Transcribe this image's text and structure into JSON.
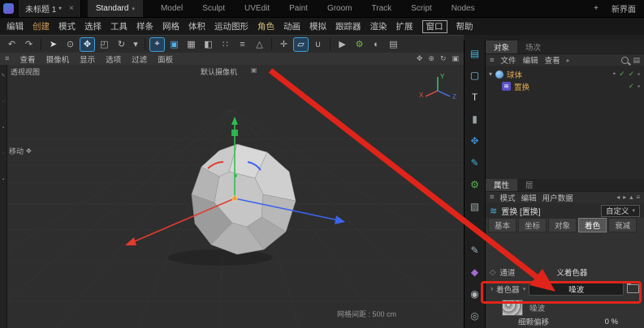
{
  "colors": {
    "annotation_red": "#e0241a",
    "check_green": "#51b44e",
    "axis_x": "#e23b2e",
    "axis_y": "#2fbf4f",
    "axis_z": "#3c64ee",
    "selected_orange": "#e0a850",
    "icon_teal": "#3fb4d8",
    "active_blue": "#3f9fd8"
  },
  "titlebar": {
    "tab": "未标题 1 *",
    "close": "×",
    "layout": "Standard",
    "layout_caret": "▾",
    "menus": [
      "Model",
      "Sculpt",
      "UVEdit",
      "Paint",
      "Groom",
      "Track",
      "Script",
      "Nodes"
    ],
    "plus": "+",
    "new_ui": "新界面"
  },
  "menubar": {
    "items": [
      "编辑",
      "创建",
      "模式",
      "选择",
      "工具",
      "样条",
      "网格",
      "体积",
      "运动图形",
      "角色",
      "动画",
      "模拟",
      "跟踪器",
      "渲染",
      "扩展",
      "窗口",
      "帮助"
    ]
  },
  "toolbar": {
    "icons": [
      {
        "name": "undo",
        "glyph": "↶"
      },
      {
        "name": "redo",
        "glyph": "↷"
      },
      {
        "name": "pointer",
        "glyph": "➤"
      },
      {
        "name": "live-selection",
        "glyph": "⊙"
      },
      {
        "name": "move-tool",
        "glyph": "✥"
      },
      {
        "name": "scale-tool",
        "glyph": "◰"
      },
      {
        "name": "rotate-tool",
        "glyph": "↻"
      },
      {
        "name": "last-tool",
        "glyph": "▾"
      },
      {
        "name": "coord-system",
        "glyph": "⌖"
      },
      {
        "name": "make-editable",
        "glyph": "▣"
      },
      {
        "name": "model-mode",
        "glyph": "▦"
      },
      {
        "name": "texture-mode",
        "glyph": "◧"
      },
      {
        "name": "points-mode",
        "glyph": "∷"
      },
      {
        "name": "edges-mode",
        "glyph": "≡"
      },
      {
        "name": "polygons-mode",
        "glyph": "△"
      },
      {
        "name": "axis-mode",
        "glyph": "✛"
      },
      {
        "name": "workplane",
        "glyph": "▱"
      },
      {
        "name": "snap",
        "glyph": "∪"
      },
      {
        "name": "render-view",
        "glyph": "▶"
      },
      {
        "name": "render-settings",
        "glyph": "⚙"
      },
      {
        "name": "material-manager",
        "glyph": "◐"
      },
      {
        "name": "content-browser",
        "glyph": "▤"
      }
    ]
  },
  "viewport": {
    "view_label": "透视视图",
    "camera_label": "默认摄像机",
    "camera_icon": "▣",
    "menu_icon": "≡",
    "menu": [
      "查看",
      "摄像机",
      "显示",
      "选项",
      "过滤",
      "面板"
    ],
    "nav_icons": [
      {
        "name": "pan",
        "glyph": "✥"
      },
      {
        "name": "zoom",
        "glyph": "⊕"
      },
      {
        "name": "orbit",
        "glyph": "↻"
      },
      {
        "name": "maximize",
        "glyph": "▣"
      }
    ],
    "move_label": "移动",
    "move_glyph": "✥",
    "grid_spacing": "网格间距 : 500 cm",
    "axis_x": "X",
    "axis_y": "Y",
    "axis_z": "Z"
  },
  "left_strip": {
    "icons": [
      {
        "name": "pen",
        "glyph": "✎"
      },
      {
        "name": "dot-a",
        "glyph": "◦"
      },
      {
        "name": "swatch-a",
        "glyph": "▪"
      },
      {
        "name": "dot-b",
        "glyph": "◦"
      },
      {
        "name": "swatch-b",
        "glyph": "▪"
      }
    ]
  },
  "right_toolbar": {
    "icons": [
      {
        "name": "layer-panel",
        "glyph": "▤"
      },
      {
        "name": "frame",
        "glyph": "▢"
      },
      {
        "name": "text-tool",
        "glyph": "T"
      },
      {
        "name": "column",
        "glyph": "▮"
      },
      {
        "name": "move-axes",
        "glyph": "✥"
      },
      {
        "name": "pen",
        "glyph": "✎"
      },
      {
        "name": "simulate-gear",
        "glyph": "⚙"
      },
      {
        "name": "cube",
        "glyph": "▧"
      },
      {
        "name": "spline",
        "glyph": "≈"
      },
      {
        "name": "pen-b",
        "glyph": "✎"
      },
      {
        "name": "deformer",
        "glyph": "◆"
      },
      {
        "name": "figure",
        "glyph": "◉"
      },
      {
        "name": "globe",
        "glyph": "◎"
      }
    ]
  },
  "object_panel": {
    "tabs": [
      "对象",
      "场次"
    ],
    "menu_icon": "≡",
    "menus": [
      "文件",
      "编辑",
      "查看"
    ],
    "overflow": "▸",
    "grid_icon": "▤",
    "tree": [
      {
        "expander": "▾",
        "label": "球体",
        "dot": "•",
        "check1": "✓",
        "check2": "✓",
        "tag": "▪"
      },
      {
        "icon": "≋",
        "label": "置换",
        "check1": "✓",
        "tag": "▪"
      }
    ]
  },
  "attributes": {
    "tabs": [
      "属性",
      "层"
    ],
    "menu_icon": "≡",
    "mode_menu": [
      "模式",
      "编辑",
      "用户数据"
    ],
    "nav": [
      "◂",
      "▸",
      "▴",
      "≡"
    ],
    "type_icon": "≋",
    "title": "置换 [置换]",
    "preset": "自定义",
    "preset_caret": "▾",
    "tab_items": [
      "基本",
      "坐标",
      "对象",
      "着色",
      "衰减"
    ],
    "channel_icon": "◇",
    "channel_label": "通道",
    "channel_value": "义着色器",
    "shader_expander": "›",
    "shader_label": "着色器",
    "shader_caret": "▾",
    "shader_button": "噪波",
    "thumb_label": "噪波",
    "param_label": "细颗偏移",
    "param_value": "0 %"
  }
}
